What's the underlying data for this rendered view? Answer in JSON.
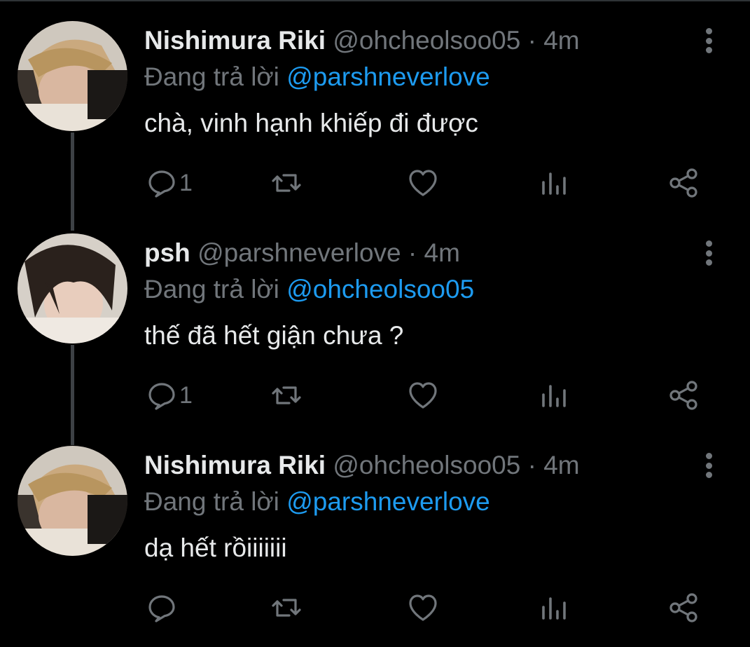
{
  "colors": {
    "background": "#000000",
    "primary_text": "#e7e9ea",
    "secondary_text": "#71767b",
    "accent": "#1d9bf0",
    "thread_line": "#3d4145"
  },
  "reply_prefix": "Đang trả lời",
  "tweets": [
    {
      "display_name": "Nishimura Riki",
      "handle": "@ohcheolsoo05",
      "time": "· 4m",
      "reply_to": "@parshneverlove",
      "text": "chà, vinh hạnh khiếp đi được",
      "reply_count": "1",
      "avatar_icon": "avatar-photo"
    },
    {
      "display_name": "psh",
      "handle": "@parshneverlove",
      "time": "· 4m",
      "reply_to": "@ohcheolsoo05",
      "text": "thế đã hết giận chưa ?",
      "reply_count": "1",
      "avatar_icon": "avatar-photo"
    },
    {
      "display_name": "Nishimura Riki",
      "handle": "@ohcheolsoo05",
      "time": "· 4m",
      "reply_to": "@parshneverlove",
      "text": "dạ hết rồiiiiiii",
      "reply_count": "",
      "avatar_icon": "avatar-photo"
    }
  ],
  "action_icons": [
    "reply-icon",
    "retweet-icon",
    "like-icon",
    "analytics-icon",
    "share-icon"
  ]
}
